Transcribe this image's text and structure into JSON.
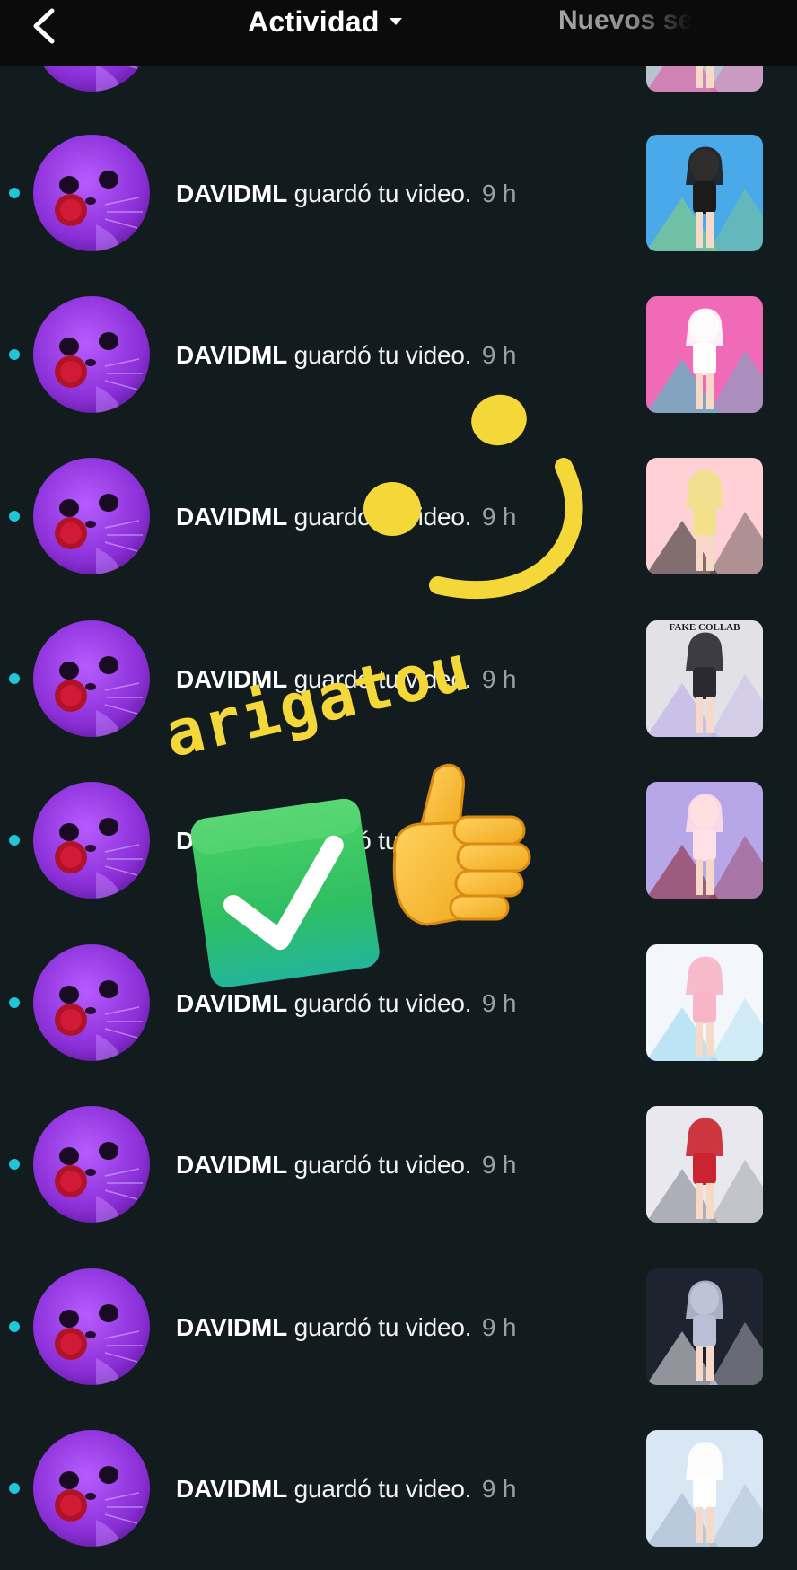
{
  "topbar": {
    "title": "Actividad",
    "next_tab": "Nuevos se"
  },
  "rows": [
    {
      "username": "DAVIDML",
      "action": "guardó tu video.",
      "time": "9 h"
    },
    {
      "username": "DAVIDML",
      "action": "guardó tu video.",
      "time": "9 h"
    },
    {
      "username": "DAVIDML",
      "action": "guardó tu video.",
      "time": "9 h"
    },
    {
      "username": "DAVIDML",
      "action": "guardó tu video.",
      "time": "9 h"
    },
    {
      "username": "DAVIDML",
      "action": "guardó tu video.",
      "time": "9 h"
    },
    {
      "username": "DAVIDML",
      "action": "guardó tu video.",
      "time": "9 h"
    },
    {
      "username": "DAVIDML",
      "action": "guardó tu video.",
      "time": "9 h"
    },
    {
      "username": "DAVIDML",
      "action": "guardó tu video.",
      "time": "9 h"
    },
    {
      "username": "DAVIDML",
      "action": "guardó tu video.",
      "time": "9 h"
    },
    {
      "username": "DAVIDML",
      "action": "guardó tu video.",
      "time": "9 h"
    }
  ],
  "thumbnails": [
    {
      "caption": ""
    },
    {
      "caption": ""
    },
    {
      "caption": ""
    },
    {
      "caption": ""
    },
    {
      "caption": "FAKE COLLAB"
    },
    {
      "caption": ""
    },
    {
      "caption": ""
    },
    {
      "caption": ""
    },
    {
      "caption": ""
    },
    {
      "caption": ""
    }
  ],
  "overlay": {
    "sticker_text": "arigatou",
    "icons": [
      "smiley-sticker-icon",
      "check-mark-icon",
      "thumbs-up-icon"
    ],
    "sticker_color": "#f4d83a"
  },
  "colors": {
    "background": "#121b1e",
    "topbar": "#0b0b0b",
    "unread_dot": "#22c4d8",
    "time_text": "#9aa1a3"
  }
}
